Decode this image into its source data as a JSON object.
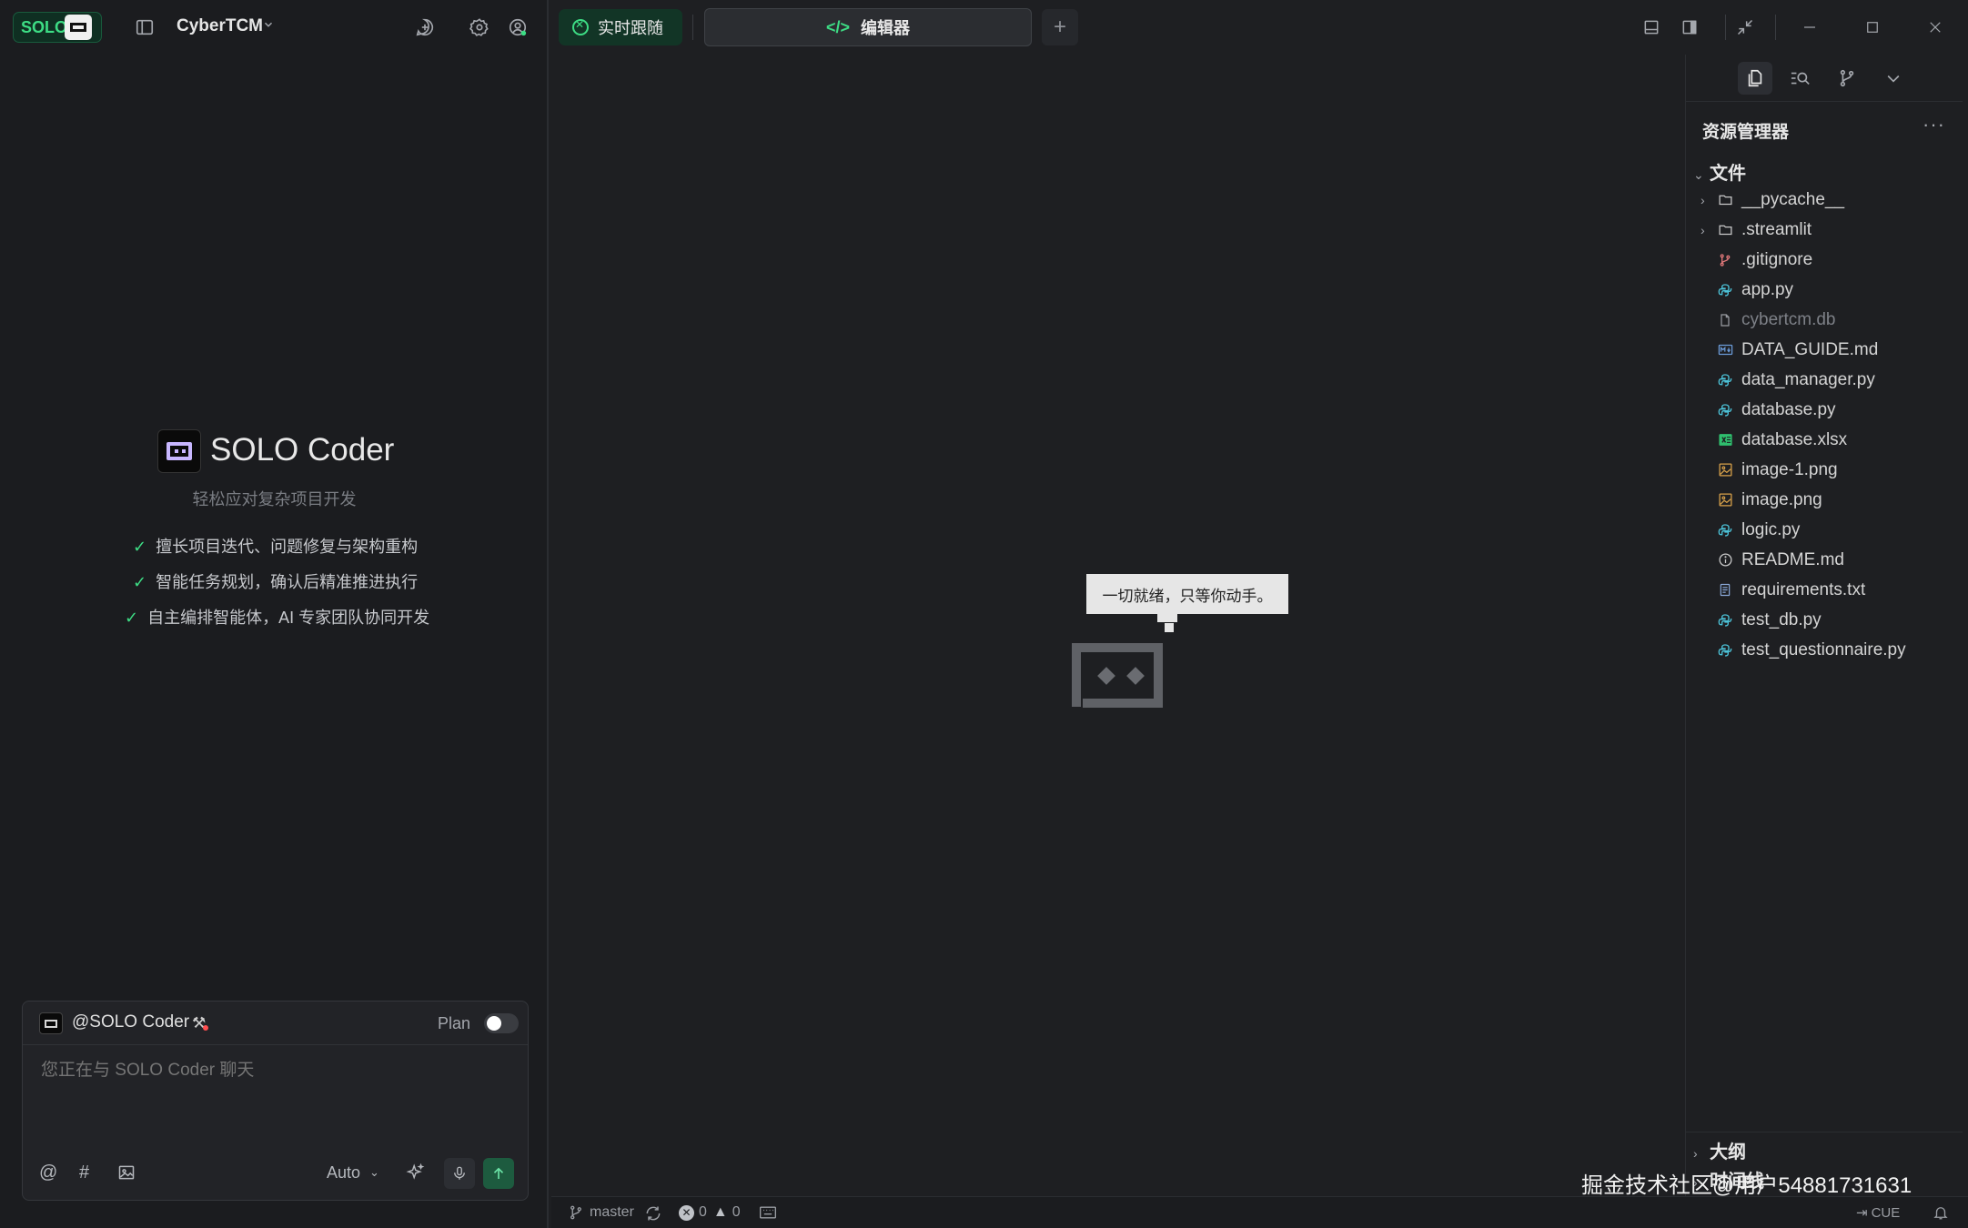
{
  "brand": {
    "logo_text": "SOLO"
  },
  "project": {
    "name": "CyberTCM"
  },
  "hero": {
    "title": "SOLO Coder",
    "subtitle": "轻松应对复杂项目开发",
    "features": [
      "擅长项目迭代、问题修复与架构重构",
      "智能任务规划，确认后精准推进执行",
      "自主编排智能体，AI 专家团队协同开发"
    ]
  },
  "chat": {
    "agent": "@SOLO Coder",
    "plan_label": "Plan",
    "plan_enabled": false,
    "placeholder": "您正在与 SOLO Coder 聊天",
    "model": "Auto",
    "mention_symbol": "@",
    "hash_symbol": "#"
  },
  "tabs": {
    "live": "实时跟随",
    "editor": "编辑器",
    "add": "+"
  },
  "editor": {
    "empty_message": "一切就绪，只等你动手。"
  },
  "explorer": {
    "title": "资源管理器",
    "more": "···",
    "section_files": "文件",
    "files": [
      {
        "name": "__pycache__",
        "type": "folder",
        "icon": "folder-icon"
      },
      {
        "name": ".streamlit",
        "type": "folder",
        "icon": "folder-icon"
      },
      {
        "name": ".gitignore",
        "type": "file",
        "icon": "git-icon",
        "color": "#e2787a"
      },
      {
        "name": "app.py",
        "type": "file",
        "icon": "python-icon",
        "color": "#4cc2d8"
      },
      {
        "name": "cybertcm.db",
        "type": "file",
        "icon": "file-icon",
        "dim": true
      },
      {
        "name": "DATA_GUIDE.md",
        "type": "file",
        "icon": "markdown-icon",
        "color": "#6b9bd8"
      },
      {
        "name": "data_manager.py",
        "type": "file",
        "icon": "python-icon",
        "color": "#4cc2d8"
      },
      {
        "name": "database.py",
        "type": "file",
        "icon": "python-icon",
        "color": "#4cc2d8"
      },
      {
        "name": "database.xlsx",
        "type": "file",
        "icon": "excel-icon",
        "color": "#2fbf6e"
      },
      {
        "name": "image-1.png",
        "type": "file",
        "icon": "image-icon",
        "color": "#d9a24a"
      },
      {
        "name": "image.png",
        "type": "file",
        "icon": "image-icon",
        "color": "#d9a24a"
      },
      {
        "name": "logic.py",
        "type": "file",
        "icon": "python-icon",
        "color": "#4cc2d8"
      },
      {
        "name": "README.md",
        "type": "file",
        "icon": "info-icon",
        "color": "#c9c9c9"
      },
      {
        "name": "requirements.txt",
        "type": "file",
        "icon": "text-file-icon",
        "color": "#8aa8d8"
      },
      {
        "name": "test_db.py",
        "type": "file",
        "icon": "python-icon",
        "color": "#4cc2d8"
      },
      {
        "name": "test_questionnaire.py",
        "type": "file",
        "icon": "python-icon",
        "color": "#4cc2d8"
      }
    ],
    "section_outline": "大纲",
    "section_timeline": "时间线"
  },
  "status": {
    "branch": "master",
    "errors": "0",
    "warnings": "0",
    "cue": "CUE"
  },
  "watermark": "掘金技术社区@用户54881731631",
  "colors": {
    "accent": "#3ddc84",
    "background": "#1e1f22"
  }
}
